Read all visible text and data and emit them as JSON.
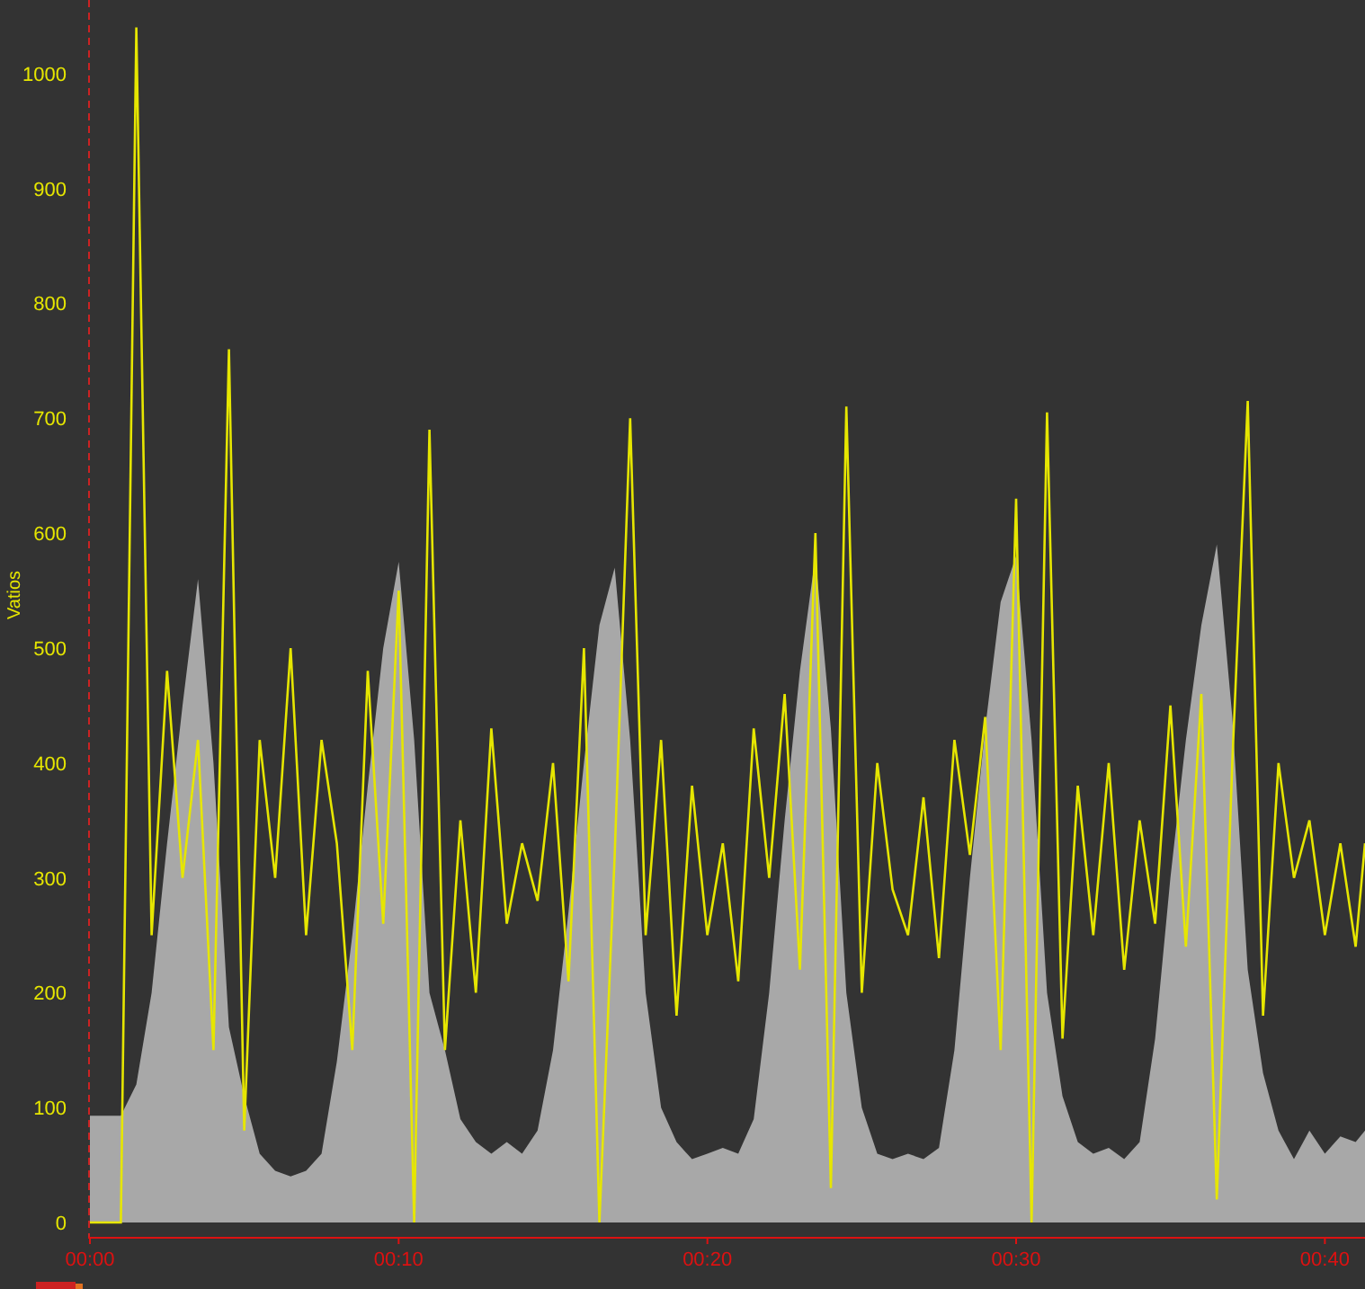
{
  "chart_data": {
    "type": "line",
    "ylabel": "Vatios",
    "xlim": [
      0,
      41.3
    ],
    "ylim": [
      0,
      1064
    ],
    "yticks": [
      0,
      100,
      200,
      300,
      400,
      500,
      600,
      700,
      800,
      900,
      1000
    ],
    "xticks": [
      {
        "value": 0,
        "label": "00:00"
      },
      {
        "value": 10,
        "label": "00:10"
      },
      {
        "value": 20,
        "label": "00:20"
      },
      {
        "value": 30,
        "label": "00:30"
      },
      {
        "value": 40,
        "label": "00:40"
      }
    ],
    "x": [
      0,
      0.5,
      1,
      1.5,
      2,
      2.5,
      3,
      3.5,
      4,
      4.5,
      5,
      5.5,
      6,
      6.5,
      7,
      7.5,
      8,
      8.5,
      9,
      9.5,
      10,
      10.5,
      11,
      11.5,
      12,
      12.5,
      13,
      13.5,
      14,
      14.5,
      15,
      15.5,
      16,
      16.5,
      17,
      17.5,
      18,
      18.5,
      19,
      19.5,
      20,
      20.5,
      21,
      21.5,
      22,
      22.5,
      23,
      23.5,
      24,
      24.5,
      25,
      25.5,
      26,
      26.5,
      27,
      27.5,
      28,
      28.5,
      29,
      29.5,
      30,
      30.5,
      31,
      31.5,
      32,
      32.5,
      33,
      33.5,
      34,
      34.5,
      35,
      35.5,
      36,
      36.5,
      37,
      37.5,
      38,
      38.5,
      39,
      39.5,
      40,
      40.5,
      41,
      41.3
    ],
    "series": [
      {
        "type": "area",
        "color": "#a8a8a8",
        "values": [
          93,
          93,
          93,
          120,
          200,
          330,
          450,
          560,
          400,
          170,
          110,
          60,
          45,
          40,
          45,
          60,
          140,
          250,
          380,
          500,
          575,
          420,
          200,
          150,
          90,
          70,
          60,
          70,
          60,
          80,
          150,
          270,
          400,
          520,
          570,
          420,
          200,
          100,
          70,
          55,
          60,
          65,
          60,
          90,
          200,
          350,
          480,
          580,
          430,
          200,
          100,
          60,
          55,
          60,
          55,
          65,
          150,
          300,
          430,
          540,
          580,
          420,
          200,
          110,
          70,
          60,
          65,
          55,
          70,
          160,
          300,
          420,
          520,
          590,
          440,
          220,
          130,
          80,
          55,
          80,
          60,
          75,
          70,
          80
        ]
      },
      {
        "type": "line",
        "color": "#e6e600",
        "values": [
          0,
          0,
          0,
          1040,
          250,
          480,
          300,
          420,
          150,
          760,
          80,
          420,
          300,
          500,
          250,
          420,
          330,
          150,
          480,
          260,
          550,
          0,
          690,
          150,
          350,
          200,
          430,
          260,
          330,
          280,
          400,
          210,
          500,
          0,
          320,
          700,
          250,
          420,
          180,
          380,
          250,
          330,
          210,
          430,
          300,
          460,
          220,
          600,
          30,
          710,
          200,
          400,
          290,
          250,
          370,
          230,
          420,
          320,
          440,
          150,
          630,
          0,
          705,
          160,
          380,
          250,
          400,
          220,
          350,
          260,
          450,
          240,
          460,
          20,
          400,
          715,
          180,
          400,
          300,
          350,
          250,
          330,
          240,
          330
        ]
      }
    ]
  }
}
